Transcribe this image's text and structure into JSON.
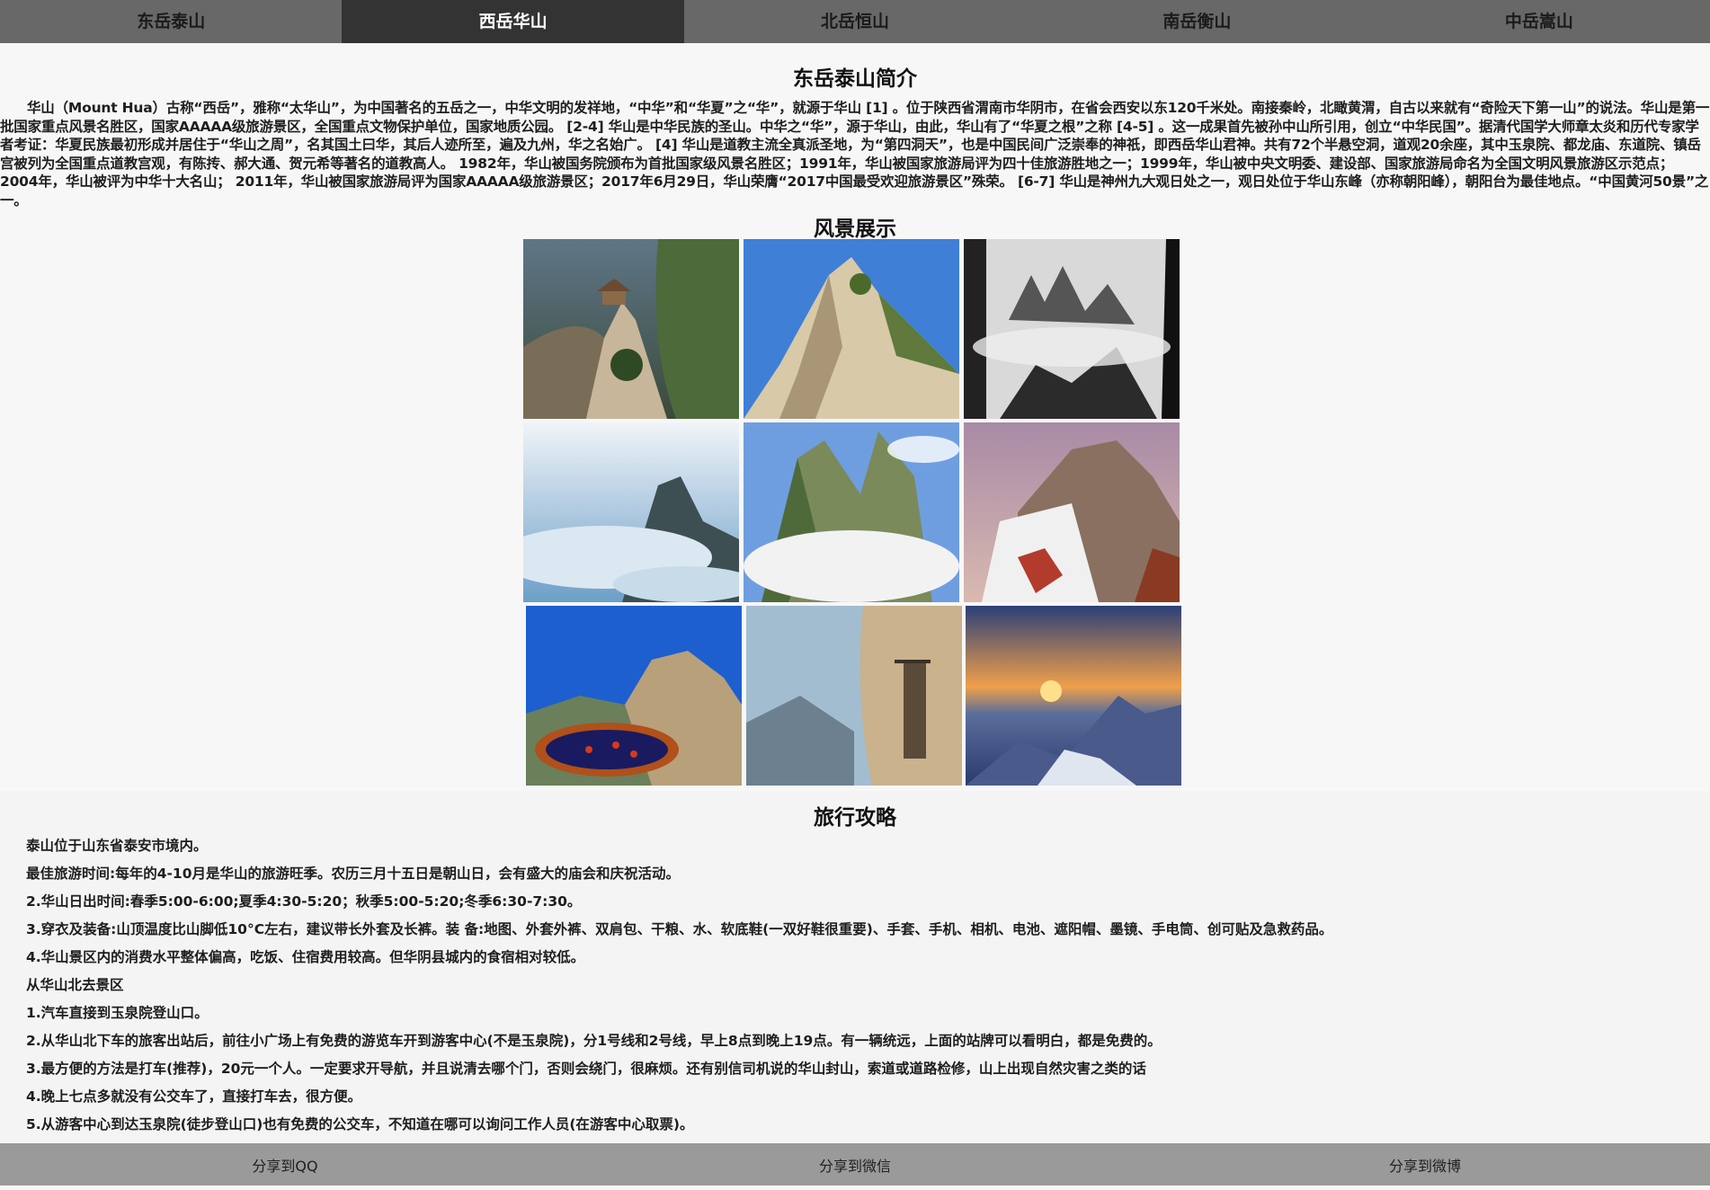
{
  "nav": {
    "items": [
      {
        "label": "东岳泰山"
      },
      {
        "label": "西岳华山"
      },
      {
        "label": "北岳恒山"
      },
      {
        "label": "南岳衡山"
      },
      {
        "label": "中岳嵩山"
      }
    ],
    "active_index": 1
  },
  "intro": {
    "title": "东岳泰山简介",
    "text": "华山（Mount Hua）古称“西岳”，雅称“太华山”，为中国著名的五岳之一，中华文明的发祥地，“中华”和“华夏”之“华”，就源于华山 [1] 。位于陕西省渭南市华阴市，在省会西安以东120千米处。南接秦岭，北瞰黄渭，自古以来就有“奇险天下第一山”的说法。华山是第一批国家重点风景名胜区，国家AAAAA级旅游景区，全国重点文物保护单位，国家地质公园。 [2-4] 华山是中华民族的圣山。中华之“华”，源于华山，由此，华山有了“华夏之根”之称 [4-5] 。这一成果首先被孙中山所引用，创立“中华民国”。据清代国学大师章太炎和历代专家学者考证：华夏民族最初形成并居住于“华山之周”，名其国土曰华，其后人迹所至，遍及九州，华之名始广。 [4] 华山是道教主流全真派圣地，为“第四洞天”，也是中国民间广泛崇奉的神祇，即西岳华山君神。共有72个半悬空洞，道观20余座，其中玉泉院、都龙庙、东道院、镇岳宫被列为全国重点道教宫观，有陈抟、郝大通、贺元希等著名的道教高人。 1982年，华山被国务院颁布为首批国家级风景名胜区；1991年，华山被国家旅游局评为四十佳旅游胜地之一；1999年，华山被中央文明委、建设部、国家旅游局命名为全国文明风景旅游区示范点；2004年，华山被评为中华十大名山； 2011年，华山被国家旅游局评为国家AAAAA级旅游景区；2017年6月29日，华山荣膺“2017中国最受欢迎旅游景区”殊荣。 [6-7] 华山是神州九大观日处之一，观日处位于华山东峰（亦称朝阳峰），朝阳台为最佳地点。“中国黄河50景”之一。"
  },
  "gallery": {
    "title": "风景展示",
    "photos": [
      {
        "icon": "mountain-pavilion-photo"
      },
      {
        "icon": "granite-peak-photo"
      },
      {
        "icon": "misty-peaks-photo"
      },
      {
        "icon": "cloud-sea-photo"
      },
      {
        "icon": "green-cliff-photo"
      },
      {
        "icon": "snow-ridge-photo"
      },
      {
        "icon": "summit-pond-photo"
      },
      {
        "icon": "cliff-plank-road-photo"
      },
      {
        "icon": "sunrise-photo"
      }
    ]
  },
  "travel": {
    "title": "旅行攻略",
    "lines": [
      "泰山位于山东省泰安市境内。",
      "最佳旅游时间:每年的4-10月是华山的旅游旺季。农历三月十五日是朝山日，会有盛大的庙会和庆祝活动。",
      "2.华山日出时间:春季5:00-6:00;夏季4:30-5:20；秋季5:00-5:20;冬季6:30-7:30。",
      "3.穿衣及装备:山顶温度比山脚低10°C左右，建议带长外套及长裤。装 备:地图、外套外裤、双肩包、干粮、水、软底鞋(一双好鞋很重要)、手套、手机、相机、电池、遮阳帽、墨镜、手电筒、创可贴及急救药品。",
      "4.华山景区内的消费水平整体偏高，吃饭、住宿费用较高。但华阴县城内的食宿相对较低。",
      "从华山北去景区",
      "1.汽车直接到玉泉院登山口。",
      "2.从华山北下车的旅客出站后，前往小广场上有免费的游览车开到游客中心(不是玉泉院)，分1号线和2号线，早上8点到晚上19点。有一辆统远，上面的站牌可以看明白，都是免费的。",
      "3.最方便的方法是打车(推荐)，20元一个人。一定要求开导航，并且说清去哪个门，否则会绕门，很麻烦。还有别信司机说的华山封山，索道或道路检修，山上出现自然灾害之类的话",
      "4.晚上七点多就没有公交车了，直接打车去，很方便。",
      "5.从游客中心到达玉泉院(徒步登山口)也有免费的公交车，不知道在哪可以询问工作人员(在游客中心取票)。"
    ]
  },
  "footer": {
    "share_qq": "分享到QQ",
    "share_wechat": "分享到微信",
    "share_weibo": "分享到微博"
  }
}
